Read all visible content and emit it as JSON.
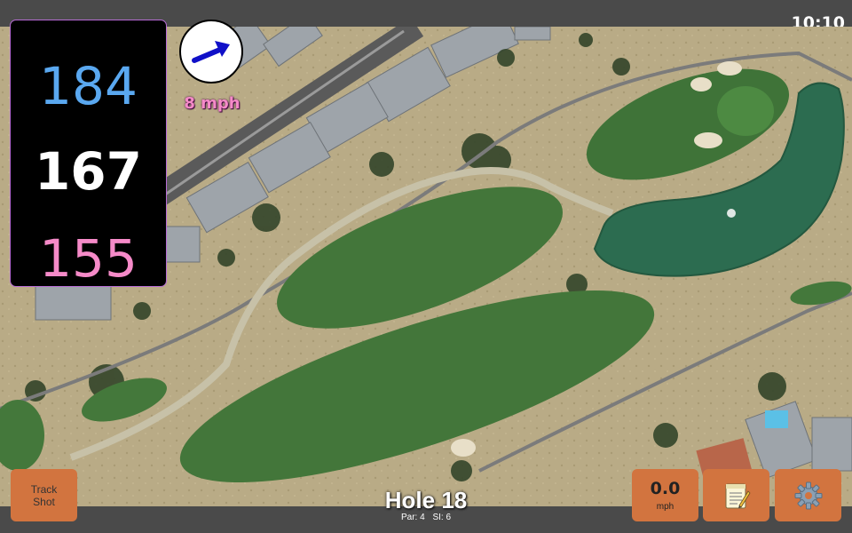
{
  "status_bar": {
    "time": "10:10"
  },
  "distances": {
    "back": "184",
    "middle": "167",
    "front": "155"
  },
  "wind": {
    "speed": "8 mph",
    "direction": "east-northeast"
  },
  "hole": {
    "title": "Hole 18",
    "par": "Par: 4",
    "stroke_index": "SI: 6"
  },
  "buttons": {
    "track_shot_line1": "Track",
    "track_shot_line2": "Shot",
    "speed_value": "0.0",
    "speed_unit": "mph",
    "notes_icon": "notepad-icon",
    "settings_icon": "gear-icon"
  },
  "colors": {
    "back_distance": "#5aa8f0",
    "middle_distance": "#ffffff",
    "front_distance": "#f58ac8",
    "button": "#d2743f",
    "panel_border": "#b86cd6"
  }
}
